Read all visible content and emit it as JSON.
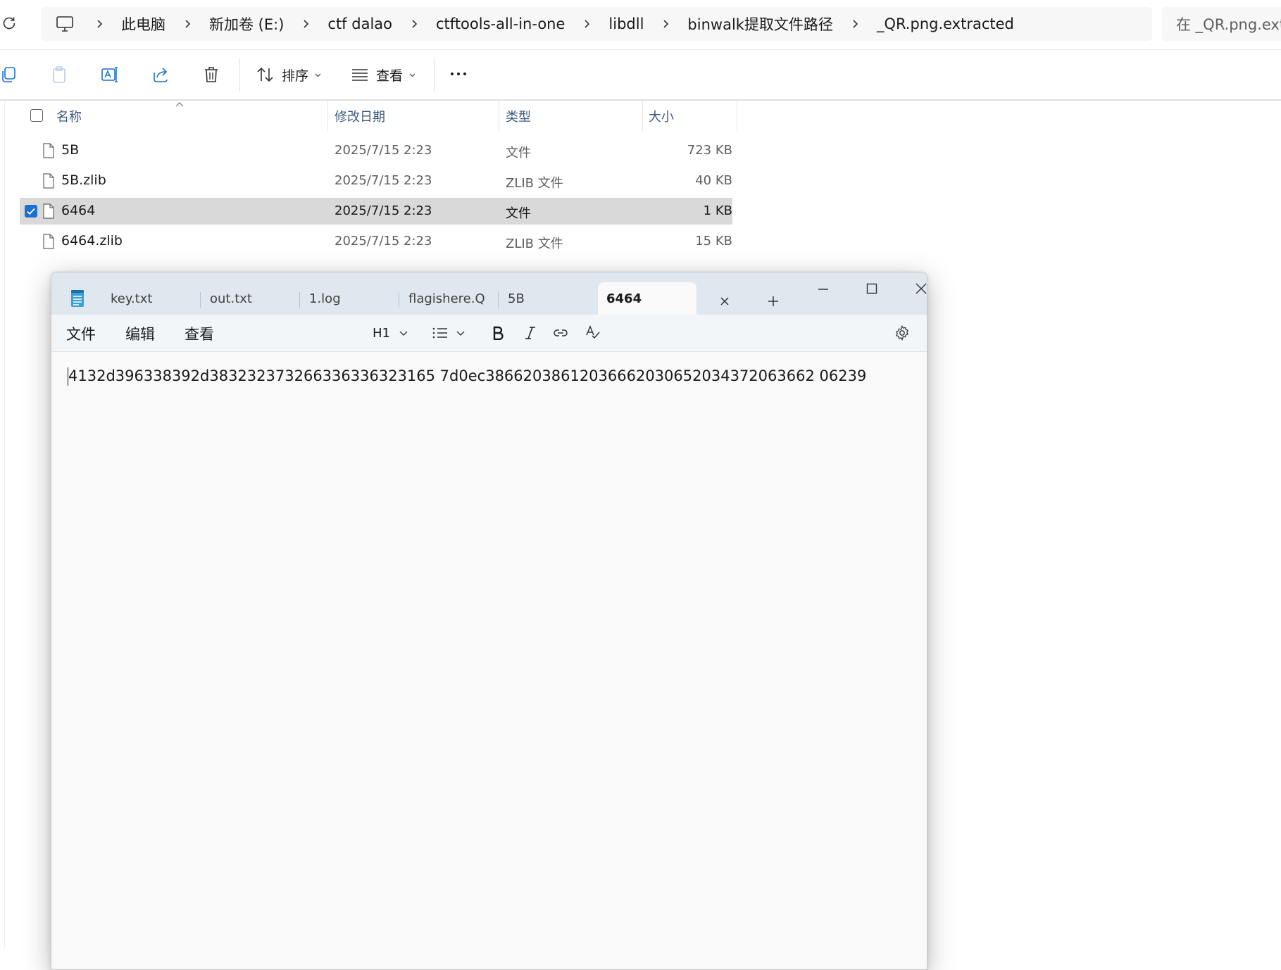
{
  "address_bar": {
    "icon": "computer-icon",
    "breadcrumbs": [
      "此电脑",
      "新加卷 (E:)",
      "ctf dalao",
      "ctftools-all-in-one",
      "libdll",
      "binwalk提取文件路径",
      "_QR.png.extracted"
    ],
    "search_placeholder": "在 _QR.png.extra"
  },
  "command_bar": {
    "icons": [
      "copy-icon",
      "paste-icon",
      "rename-icon",
      "share-icon",
      "delete-icon"
    ],
    "sort_label": "排序",
    "view_label": "查看"
  },
  "file_list": {
    "columns": {
      "name": "名称",
      "date": "修改日期",
      "type": "类型",
      "size": "大小"
    },
    "files": [
      {
        "name": "5B",
        "date": "2025/7/15 2:23",
        "type": "文件",
        "size": "723 KB",
        "selected": false
      },
      {
        "name": "5B.zlib",
        "date": "2025/7/15 2:23",
        "type": "ZLIB 文件",
        "size": "40 KB",
        "selected": false
      },
      {
        "name": "6464",
        "date": "2025/7/15 2:23",
        "type": "文件",
        "size": "1 KB",
        "selected": true
      },
      {
        "name": "6464.zlib",
        "date": "2025/7/15 2:23",
        "type": "ZLIB 文件",
        "size": "15 KB",
        "selected": false
      }
    ]
  },
  "notepad": {
    "tabs": [
      "key.txt",
      "out.txt",
      "1.log",
      "flagishere.Q",
      "5B",
      "6464"
    ],
    "active_tab": "6464",
    "menu": {
      "file": "文件",
      "edit": "编辑",
      "view": "查看"
    },
    "heading_label": "H1",
    "content": "4132d396338392d383232373266336336323165 7d0ec38662038612036662030652034372063662 06239"
  },
  "colors": {
    "selected_row": "#d9d9d9",
    "accent": "#1a6fd1",
    "notepad_titlebar": "#dfe7ef"
  }
}
